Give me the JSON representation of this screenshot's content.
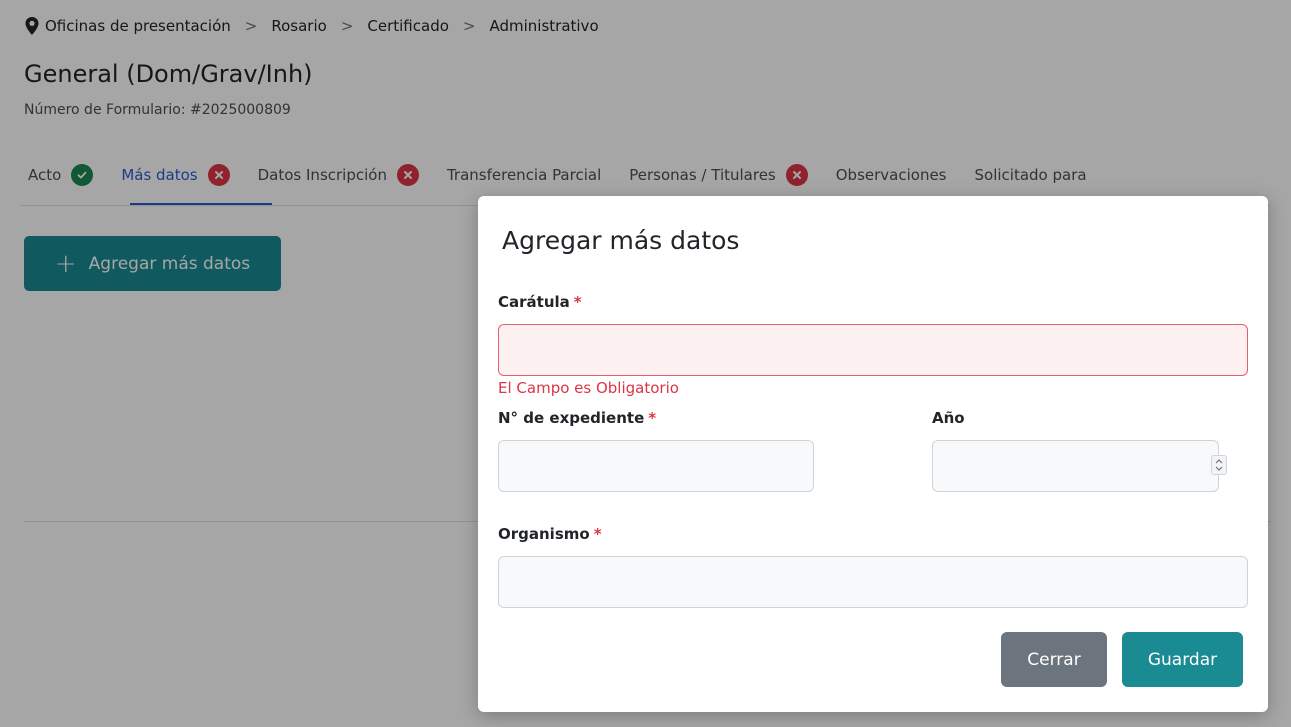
{
  "breadcrumb": {
    "items": [
      "Oficinas de presentación",
      "Rosario",
      "Certificado",
      "Administrativo"
    ],
    "separator": ">"
  },
  "header": {
    "title": "General (Dom/Grav/Inh)",
    "form_number": "Número de Formulario: #2025000809"
  },
  "tabs": [
    {
      "label": "Acto",
      "status": "ok"
    },
    {
      "label": "Más datos",
      "status": "error",
      "active": true
    },
    {
      "label": "Datos Inscripción",
      "status": "error"
    },
    {
      "label": "Transferencia Parcial",
      "status": "none"
    },
    {
      "label": "Personas / Titulares",
      "status": "error"
    },
    {
      "label": "Observaciones",
      "status": "none"
    },
    {
      "label": "Solicitado para",
      "status": "none"
    }
  ],
  "main": {
    "add_button_label": "Agregar más datos"
  },
  "modal": {
    "title": "Agregar más datos",
    "caratula": {
      "label": "Carátula",
      "required": "*",
      "value": "",
      "error": "El Campo es Obligatorio"
    },
    "expediente": {
      "label": "N° de expediente",
      "required": "*",
      "value": ""
    },
    "anio": {
      "label": "Año",
      "value": ""
    },
    "organismo": {
      "label": "Organismo",
      "required": "*",
      "value": ""
    },
    "close_label": "Cerrar",
    "save_label": "Guardar"
  },
  "colors": {
    "accent": "#1a8a93",
    "active_tab": "#2f5bd3",
    "error": "#dc3545",
    "success": "#198754",
    "secondary": "#6c757d"
  }
}
